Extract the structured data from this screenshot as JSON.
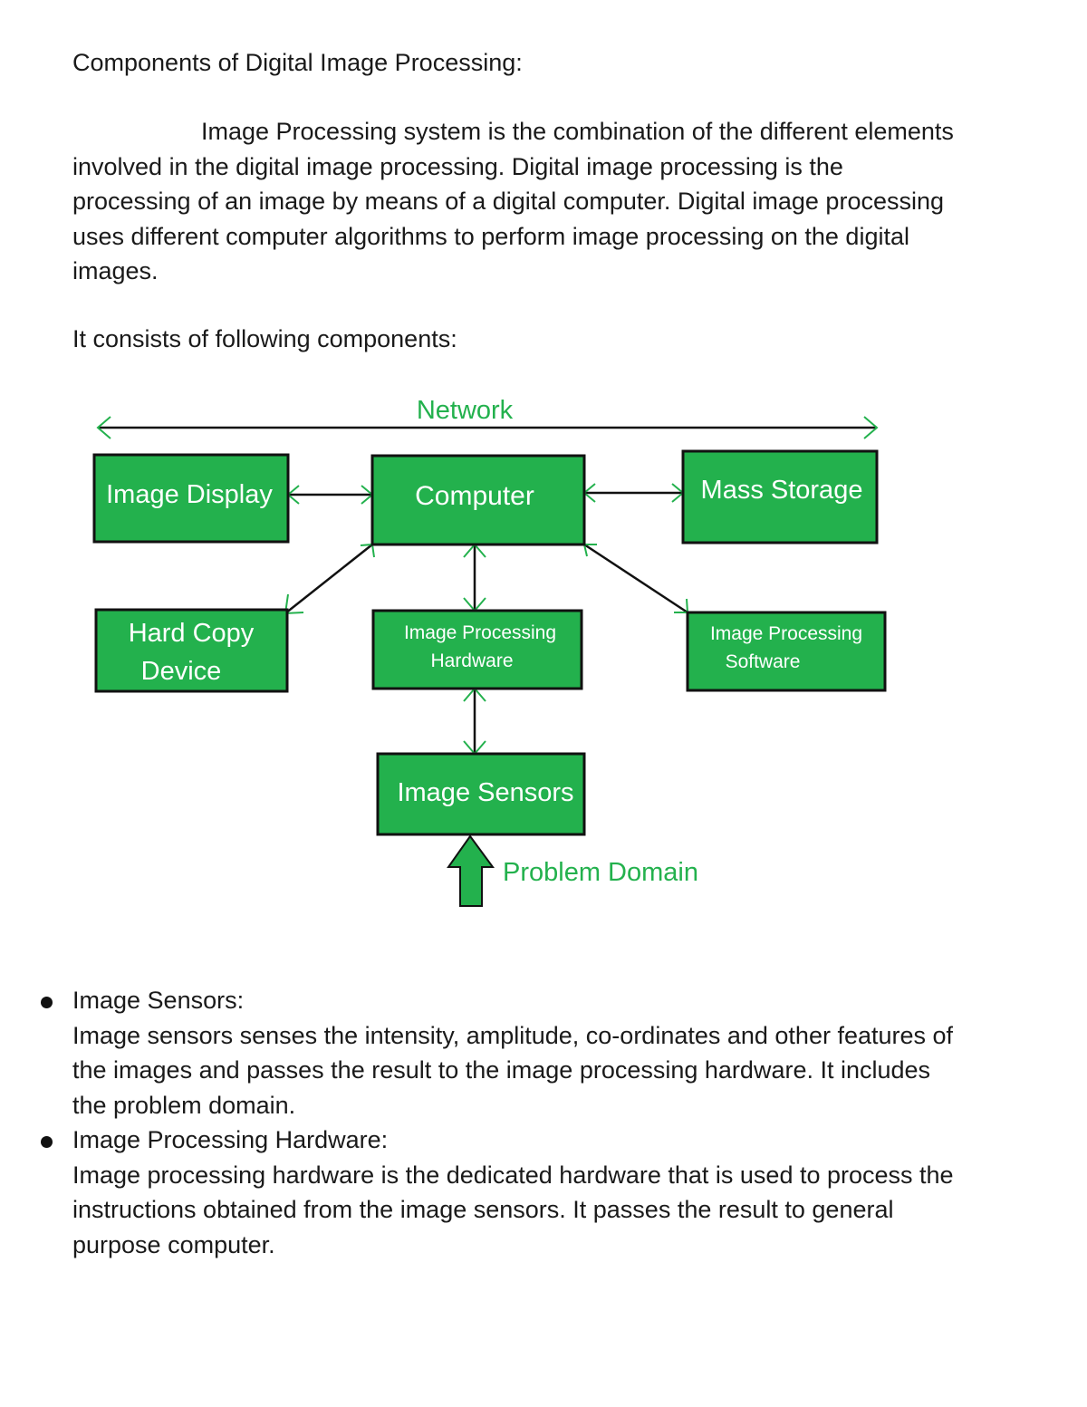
{
  "document": {
    "title": "Components of Digital Image Processing:",
    "intro_lines": [
      "Image Processing system is the combination of the different elements",
      "involved in the digital image processing. Digital image processing is the",
      "processing of an image by means of a digital computer. Digital image processing",
      "uses different computer algorithms to perform image processing on the digital",
      "images."
    ],
    "consists": "It consists of following components:"
  },
  "diagram": {
    "network_label": "Network",
    "boxes": {
      "image_display": [
        "Image Display"
      ],
      "computer": [
        "Computer"
      ],
      "mass_storage": [
        "Mass Storage"
      ],
      "hard_copy": [
        "Hard Copy",
        "Device"
      ],
      "ip_hardware": [
        "Image Processing",
        "Hardware"
      ],
      "ip_software": [
        "Image Processing",
        "Software"
      ],
      "image_sensors": [
        "Image Sensors"
      ]
    },
    "problem_domain_label": "Problem Domain",
    "colors": {
      "box_fill": "#23b14d",
      "accent_text": "#23b14d",
      "line": "#111111"
    }
  },
  "bullets": [
    {
      "heading": "Image Sensors:",
      "lines": [
        "Image sensors senses the intensity, amplitude, co-ordinates and other features of",
        "the images and passes the result to the image processing hardware. It includes",
        "the problem domain."
      ]
    },
    {
      "heading": "Image Processing Hardware:",
      "lines": [
        "Image processing hardware is the dedicated hardware that is used to process the",
        "instructions obtained from the image sensors. It passes the result to general",
        "purpose computer."
      ]
    }
  ]
}
